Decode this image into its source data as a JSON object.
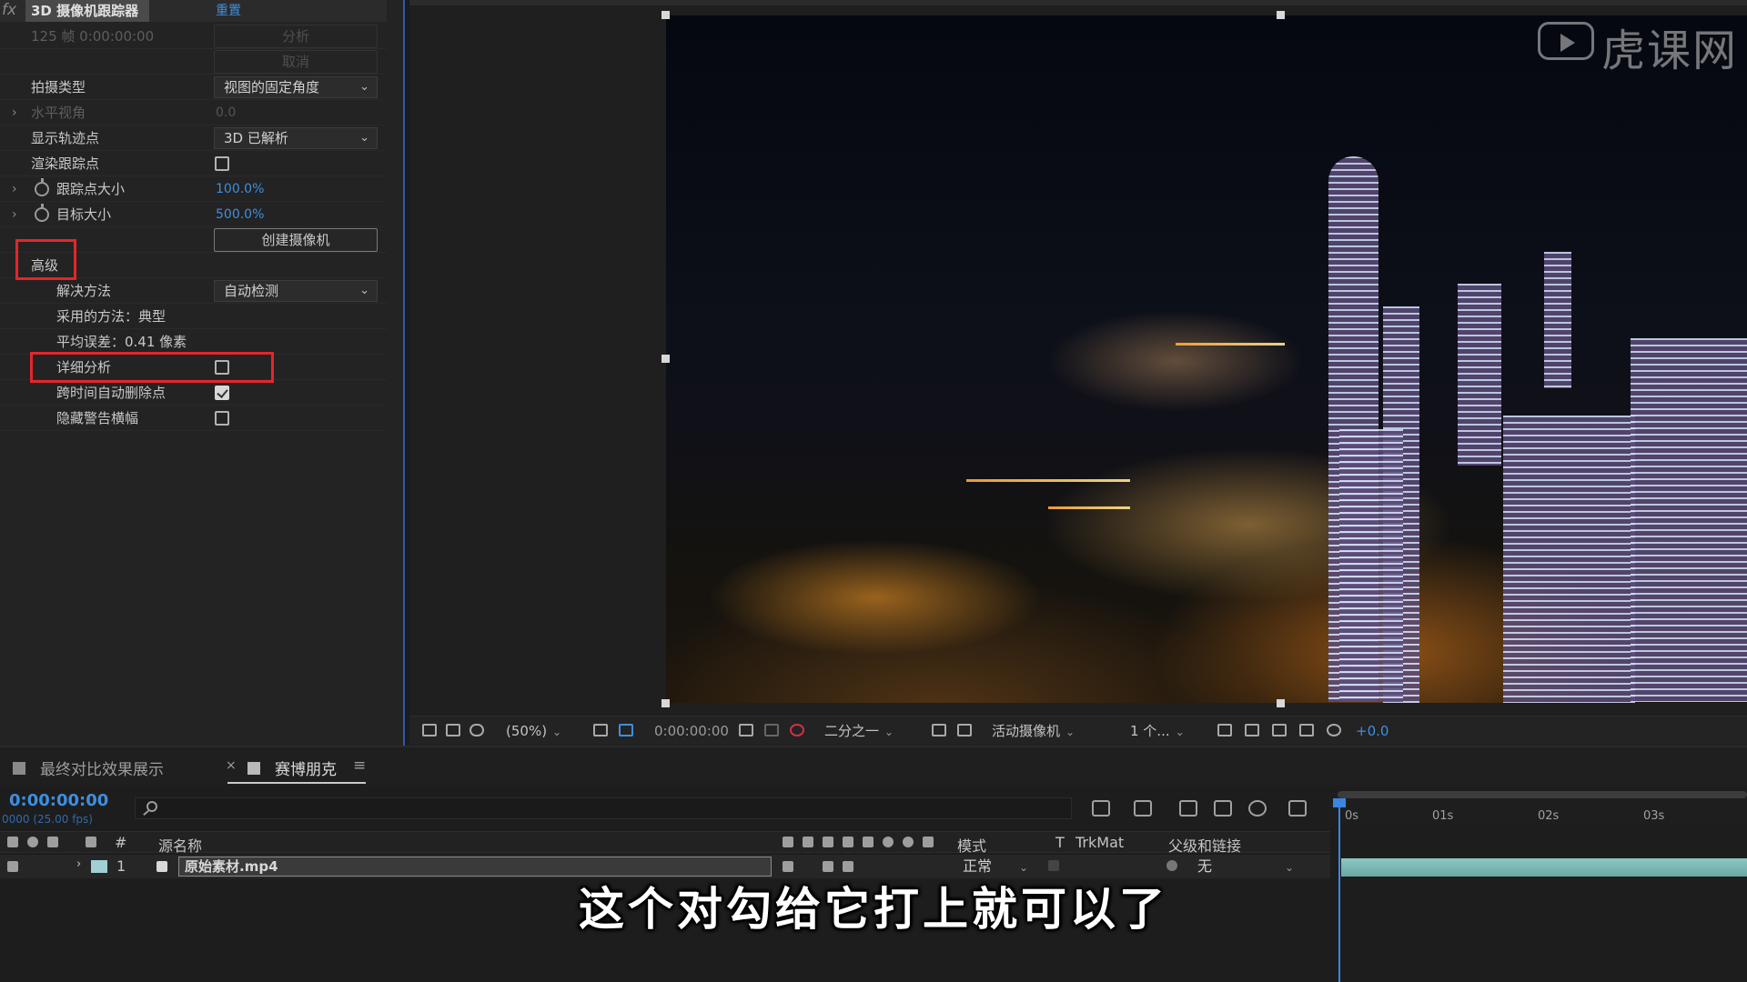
{
  "fx_panel": {
    "badge": "fx",
    "effect_title": "3D 摄像机跟踪器",
    "reset": "重置",
    "status_line": "125 帧 0:00:00:00",
    "analyze_btn": "分析",
    "cancel_btn": "取消",
    "rows": {
      "shot_type_label": "拍摄类型",
      "shot_type_value": "视图的固定角度",
      "hfov_label": "水平视角",
      "hfov_value": "0.0",
      "show_points_label": "显示轨迹点",
      "show_points_value": "3D 已解析",
      "render_points_label": "渲染跟踪点",
      "point_size_label": "跟踪点大小",
      "point_size_value": "100.0%",
      "target_size_label": "目标大小",
      "target_size_value": "500.0%",
      "create_camera_btn": "创建摄像机",
      "advanced_label": "高级",
      "solve_method_label": "解决方法",
      "solve_method_value": "自动检测",
      "method_used_label": "采用的方法：典型",
      "avg_error_label": "平均误差：0.41 像素",
      "detailed_analysis_label": "详细分析",
      "auto_delete_label": "跨时间自动删除点",
      "hide_warning_label": "隐藏警告横幅"
    },
    "checkboxes": {
      "render_points": false,
      "detailed_analysis": false,
      "auto_delete": true,
      "hide_warning": false
    },
    "highlight_color": "#e3262b"
  },
  "viewer_bar": {
    "zoom": "(50%)",
    "timecode": "0:00:00:00",
    "resolution": "二分之一",
    "camera": "活动摄像机",
    "views": "1 个...",
    "exposure": "+0.0"
  },
  "timeline": {
    "tabs": [
      {
        "label": "最终对比效果展示",
        "color": "#8a8a8a"
      },
      {
        "label": "赛博朋克",
        "color": "#b9b9b9"
      }
    ],
    "tab_close": "×",
    "tab_menu": "≡",
    "timecode": "0:00:00:00",
    "fps": "0000 (25.00 fps)",
    "ruler": [
      "0s",
      "01s",
      "02s",
      "03s"
    ],
    "columns": {
      "hash": "#",
      "source_name": "源名称",
      "mode": "模式",
      "t": "T",
      "trkmat": "TrkMat",
      "parent": "父级和链接"
    },
    "layer": {
      "index": "1",
      "name": "原始素材.mp4",
      "mode": "正常",
      "parent": "无"
    }
  },
  "subtitle": "这个对勾给它打上就可以了",
  "watermark": "虎课网"
}
